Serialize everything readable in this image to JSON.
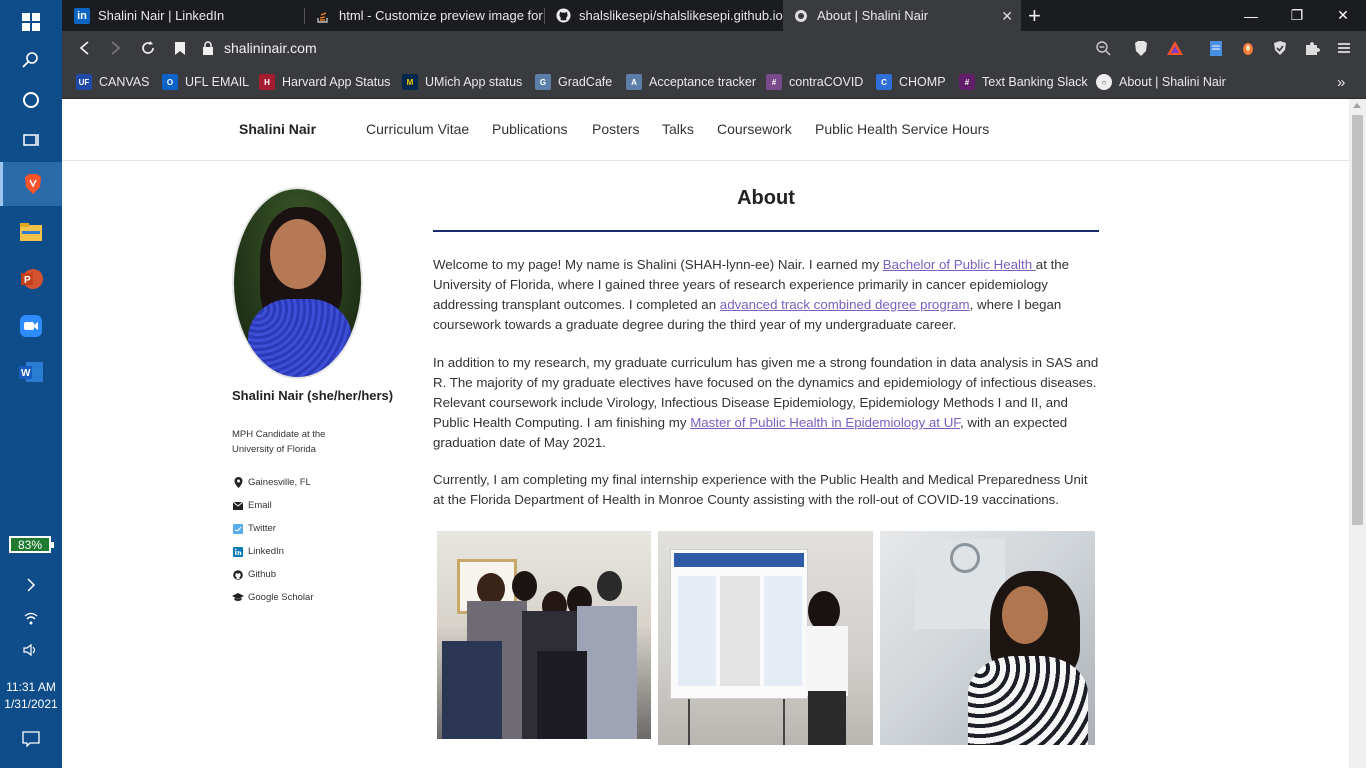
{
  "taskbar": {
    "battery": "83%",
    "time": "11:31 AM",
    "date": "1/31/2021"
  },
  "browser": {
    "tabs": [
      {
        "title": "Shalini Nair | LinkedIn",
        "icon": "linkedin-icon"
      },
      {
        "title": "html - Customize preview image for g",
        "icon": "stackoverflow-icon"
      },
      {
        "title": "shalslikesepi/shalslikesepi.github.io: Gi",
        "icon": "github-icon"
      },
      {
        "title": "About | Shalini Nair",
        "icon": "globe-icon",
        "active": true
      }
    ],
    "url": "shalininair.com",
    "bookmarks": [
      {
        "label": "CANVAS",
        "color": "#1f4aa8",
        "glyph": "UF"
      },
      {
        "label": "UFL EMAIL",
        "color": "#0a63c9",
        "glyph": "O"
      },
      {
        "label": "Harvard App Status",
        "color": "#a51c30",
        "glyph": "H"
      },
      {
        "label": "UMich App status",
        "color": "#00274c",
        "glyph": "M"
      },
      {
        "label": "GradCafe",
        "color": "#5b7fa8",
        "glyph": "G"
      },
      {
        "label": "Acceptance tracker",
        "color": "#5b7fa8",
        "glyph": "A"
      },
      {
        "label": "contraCOVID",
        "color": "#7a4a8c",
        "glyph": "#"
      },
      {
        "label": "CHOMP",
        "color": "#2e6fd8",
        "glyph": "C"
      },
      {
        "label": "Text Banking Slack",
        "color": "#611f69",
        "glyph": "#"
      },
      {
        "label": "About | Shalini Nair",
        "color": "#3a3b3f",
        "glyph": "○"
      }
    ]
  },
  "site": {
    "title": "Shalini Nair",
    "nav": [
      "Curriculum Vitae",
      "Publications",
      "Posters",
      "Talks",
      "Coursework",
      "Public Health Service Hours"
    ]
  },
  "author": {
    "name": "Shalini Nair (she/her/hers)",
    "bio": "MPH Candidate at the University of Florida",
    "links": [
      {
        "label": "Gainesville, FL",
        "icon": "location-pin-icon"
      },
      {
        "label": "Email",
        "icon": "envelope-icon"
      },
      {
        "label": "Twitter",
        "icon": "twitter-icon"
      },
      {
        "label": "LinkedIn",
        "icon": "linkedin-icon"
      },
      {
        "label": "Github",
        "icon": "github-icon"
      },
      {
        "label": "Google Scholar",
        "icon": "graduation-cap-icon"
      }
    ]
  },
  "page": {
    "title": "About",
    "p1": {
      "t1": "Welcome to my page! My name is Shalini (SHAH-lynn-ee) Nair. I earned my ",
      "link1": "Bachelor of Public Health ",
      "t2": "at the University of Florida, where I gained three years of research experience primarily in cancer epidemiology addressing transplant outcomes. I completed an ",
      "link2": "advanced track combined degree program",
      "t3": ", where I began coursework towards a graduate degree during the third year of my undergraduate career."
    },
    "p2": {
      "t1": "In addition to my research, my graduate curriculum has given me a strong foundation in data analysis in SAS and R. The majority of my graduate electives have focused on the dynamics and epidemiology of infectious diseases. Relevant coursework include Virology, Infectious Disease Epidemiology, Epidemiology Methods I and II, and Public Health Computing. I am finishing my ",
      "link1": "Master of Public Health in Epidemiology at UF",
      "t2": ", with an expected graduation date of May 2021."
    },
    "p3": "Currently, I am completing my final internship experience with the Public Health and Medical Preparedness Unit at the Florida Department of Health in Monroe County assisting with the roll-out of COVID-19 vaccinations."
  }
}
